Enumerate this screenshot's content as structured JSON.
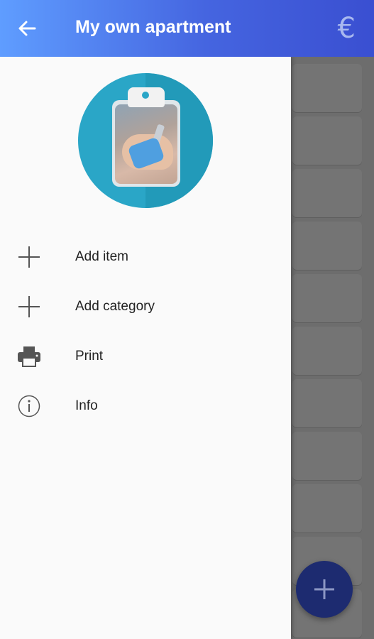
{
  "app_bar": {
    "title": "My own apartment",
    "back_icon": "arrow-left-icon",
    "currency_symbol": "€",
    "currency_icon": "euro-icon"
  },
  "drawer": {
    "header_image": "clipboard-keys-avatar",
    "items": [
      {
        "label": "Add item",
        "icon": "plus-icon"
      },
      {
        "label": "Add category",
        "icon": "plus-icon"
      },
      {
        "label": "Print",
        "icon": "printer-icon"
      },
      {
        "label": "Info",
        "icon": "info-icon"
      }
    ]
  },
  "fab": {
    "icon": "plus-icon"
  },
  "colors": {
    "appbar_start": "#5f9dff",
    "appbar_end": "#3a4fd1",
    "avatar_bg": "#2aa6c7",
    "fab_bg": "#1d2b70",
    "drawer_bg": "#fafafa"
  }
}
